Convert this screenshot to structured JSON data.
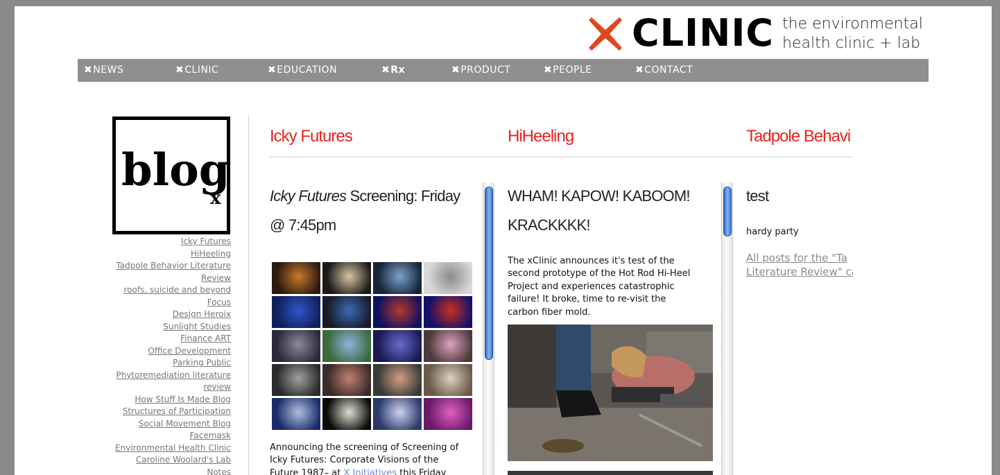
{
  "logo": {
    "word": "CLINIC",
    "tagline_1": "the environmental",
    "tagline_2": "health clinic + lab",
    "accent": "#e0471c"
  },
  "nav": {
    "items": [
      {
        "label": "NEWS"
      },
      {
        "label": "CLINIC"
      },
      {
        "label": "EDUCATION"
      },
      {
        "label": "Rx"
      },
      {
        "label": "PRODUCT"
      },
      {
        "label": "PEOPLE"
      },
      {
        "label": "CONTACT"
      }
    ],
    "marker": "✖"
  },
  "blog_logo": {
    "word": "blog",
    "sub": "x"
  },
  "sidebar": {
    "links": [
      "Icky Futures",
      "HiHeeling",
      "Tadpole Behavior Literature Review",
      "roofs, suicide and beyond Focus",
      "Design Heroix",
      "Sunlight Studies",
      "Finance ART",
      "Office Development",
      "Parking Public",
      "Phytoremediation literature review",
      "How Stuff Is Made Blog",
      "Structures of Participation",
      "Social Movement Blog",
      "Facemask",
      "Environmental Health Clinic",
      "Caroline Woolard's Lab",
      "Notes"
    ],
    "lines": [
      "Icky Futures",
      "HiHeeling",
      "Tadpole Behavior Literature",
      "Review",
      "roofs, suicide and beyond",
      "Focus",
      "Design Heroix",
      "Sunlight Studies",
      "Finance ART",
      "Office Development",
      "Parking Public",
      "Phytoremediation literature",
      "review",
      "How Stuff Is Made Blog",
      "Structures of Participation",
      "Social Movement Blog",
      "Facemask",
      "Environmental Health Clinic",
      "Caroline Woolard's Lab",
      "Notes"
    ]
  },
  "columns": [
    {
      "title": "Icky Futures",
      "post_title_italic": "Icky Futures",
      "post_title_rest": " Screening: Friday",
      "post_title_line2": "@ 7:45pm",
      "body_lines": [
        "Announcing the screening of Screening of",
        "Icky Futures: Corporate Visions of the",
        "Future 1987– at"
      ],
      "body_link": "X Initiatives",
      "body_after_link": " this Friday"
    },
    {
      "title": "HiHeeling",
      "post_title_line1": "WHAM! KAPOW! KABOOM!",
      "post_title_line2": "KRACKKKK!",
      "body_lines": [
        "The xClinic announces it's test of the",
        "second prototype of the Hot Rod Hi-Heel",
        "Project and experiences catastrophic",
        "failure! It broke, time to re-visit the",
        "carbon fiber mold."
      ]
    },
    {
      "title": "Tadpole Behavi",
      "post_title": "test",
      "body": "hardy party",
      "link_line1": "All posts for the \"Ta",
      "link_line2": "Literature Review\" ca"
    }
  ],
  "colors": {
    "title_red": "#e8231f",
    "nav_bg": "#8f8f8f",
    "frame_bg": "#8a8a8a"
  }
}
